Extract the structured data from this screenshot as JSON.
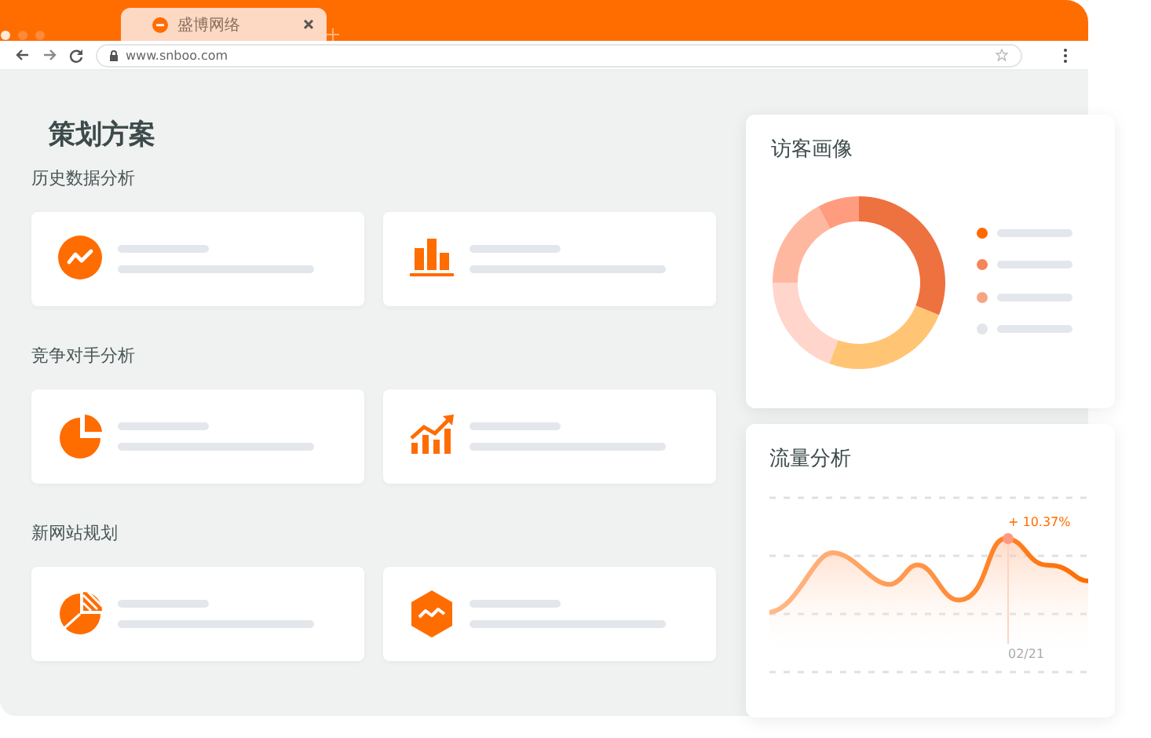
{
  "browser": {
    "tab_title": "盛博网络",
    "url": "www.snboo.com"
  },
  "page": {
    "title": "策划方案",
    "sections": [
      {
        "title": "历史数据分析",
        "cards": [
          {
            "kind": "trend"
          },
          {
            "kind": "bars"
          }
        ]
      },
      {
        "title": "竞争对手分析",
        "cards": [
          {
            "kind": "pie"
          },
          {
            "kind": "growth"
          }
        ]
      },
      {
        "title": "新网站规划",
        "cards": [
          {
            "kind": "split-pie"
          },
          {
            "kind": "hexagon"
          }
        ]
      }
    ]
  },
  "visitor_card": {
    "title": "访客画像",
    "legend": [
      {
        "color": "#ff6a00"
      },
      {
        "color": "#f4865a"
      },
      {
        "color": "#f5a584"
      },
      {
        "color": "#e2e6ea"
      }
    ]
  },
  "traffic_card": {
    "title": "流量分析",
    "peak_label": "+ 10.37%",
    "date_label": "02/21"
  }
}
